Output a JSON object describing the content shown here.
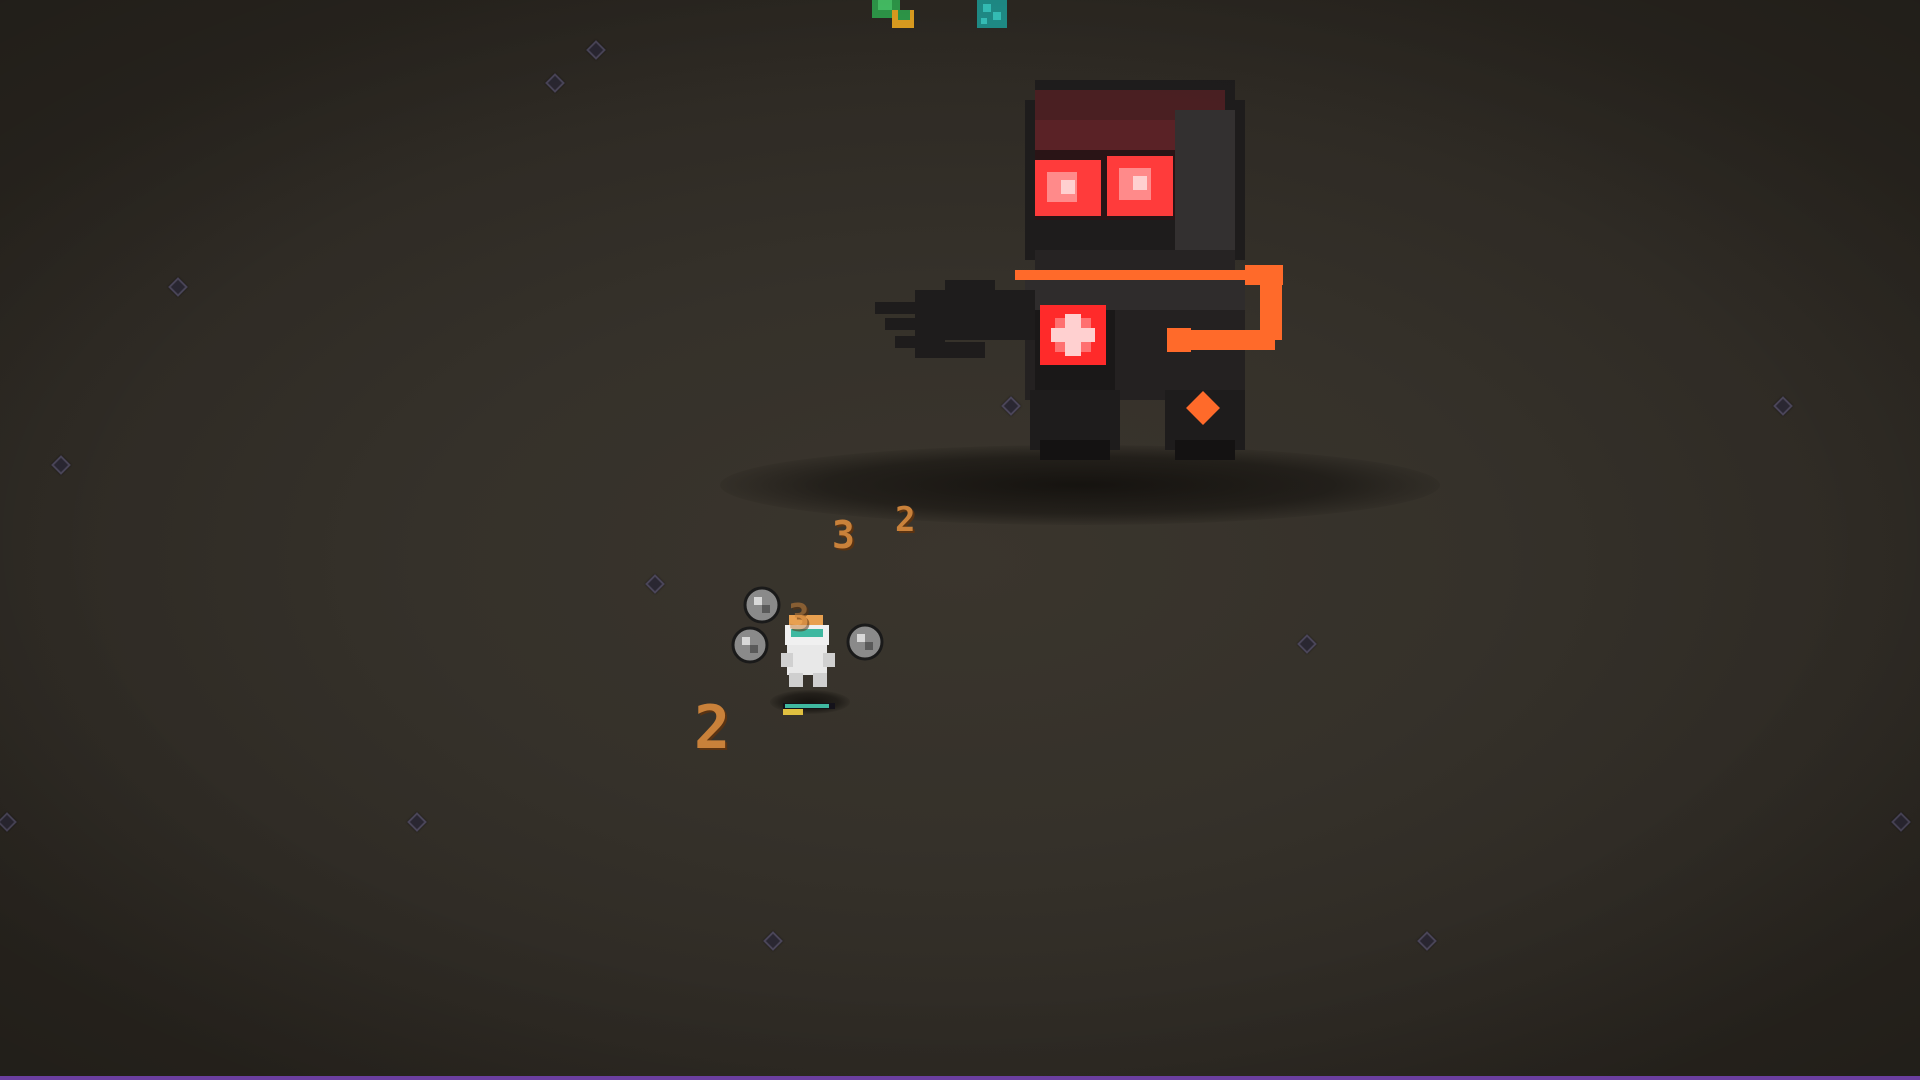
{
  "scene": {
    "background_color": "#2e2a24",
    "xp_gem_color": "#4a4558",
    "damage_text_color": "#c9813a",
    "bottom_bar_color": "#6b3fa0"
  },
  "damage_numbers": [
    {
      "value": "3"
    },
    {
      "value": "2"
    },
    {
      "value": "3"
    },
    {
      "value": "2"
    }
  ],
  "player": {
    "icon": "hero-icon",
    "orbiting_weapons": [
      "rock-orb-icon",
      "rock-orb-icon",
      "rock-orb-icon",
      "rock-orb-icon"
    ],
    "health_bar_color": "#3fb8a0"
  },
  "boss": {
    "icon": "robot-boss-icon",
    "eye_color": "#ff3b3b",
    "accent_color": "#ff6a2a",
    "body_color": "#2a2828"
  },
  "offscreen_enemies": [
    "green-enemy-icon",
    "teal-enemy-icon"
  ]
}
